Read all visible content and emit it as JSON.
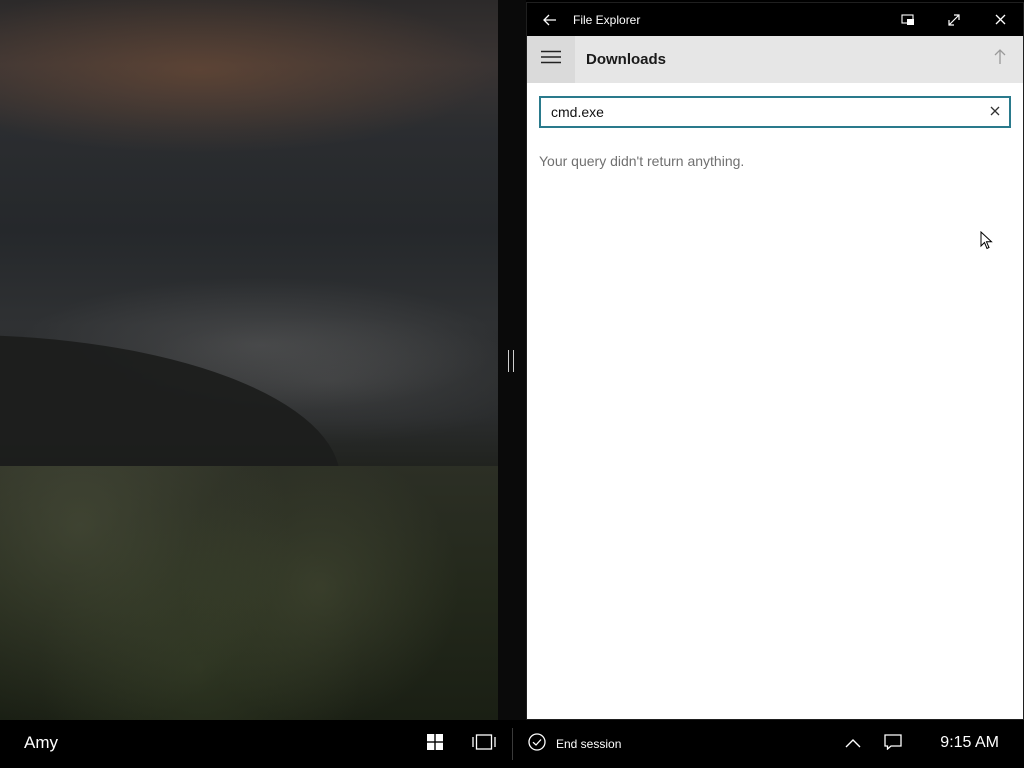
{
  "titlebar": {
    "title": "File Explorer",
    "icons": {
      "back": "back-arrow-icon",
      "compact": "compact-overlay-icon",
      "fullscreen": "fullscreen-icon",
      "close": "close-icon"
    }
  },
  "header": {
    "location": "Downloads",
    "icons": {
      "menu": "hamburger-menu-icon",
      "up": "up-arrow-icon"
    }
  },
  "search": {
    "value": "cmd.exe",
    "clear_icon": "clear-icon"
  },
  "results": {
    "empty_message": "Your query didn't return anything."
  },
  "taskbar": {
    "user_name": "Amy",
    "icons": {
      "start": "windows-start-icon",
      "task_view": "task-view-icon",
      "end_session": "checkmark-circle-icon",
      "tray_up": "chevron-up-icon",
      "action_center": "action-center-icon"
    },
    "end_session_label": "End session",
    "clock": "9:15 AM"
  },
  "colors": {
    "accent": "#2a7a8c",
    "titlebar_bg": "#000000",
    "header_bg": "#e6e6e6",
    "taskbar_bg": "#000000",
    "muted_text": "#707070"
  }
}
